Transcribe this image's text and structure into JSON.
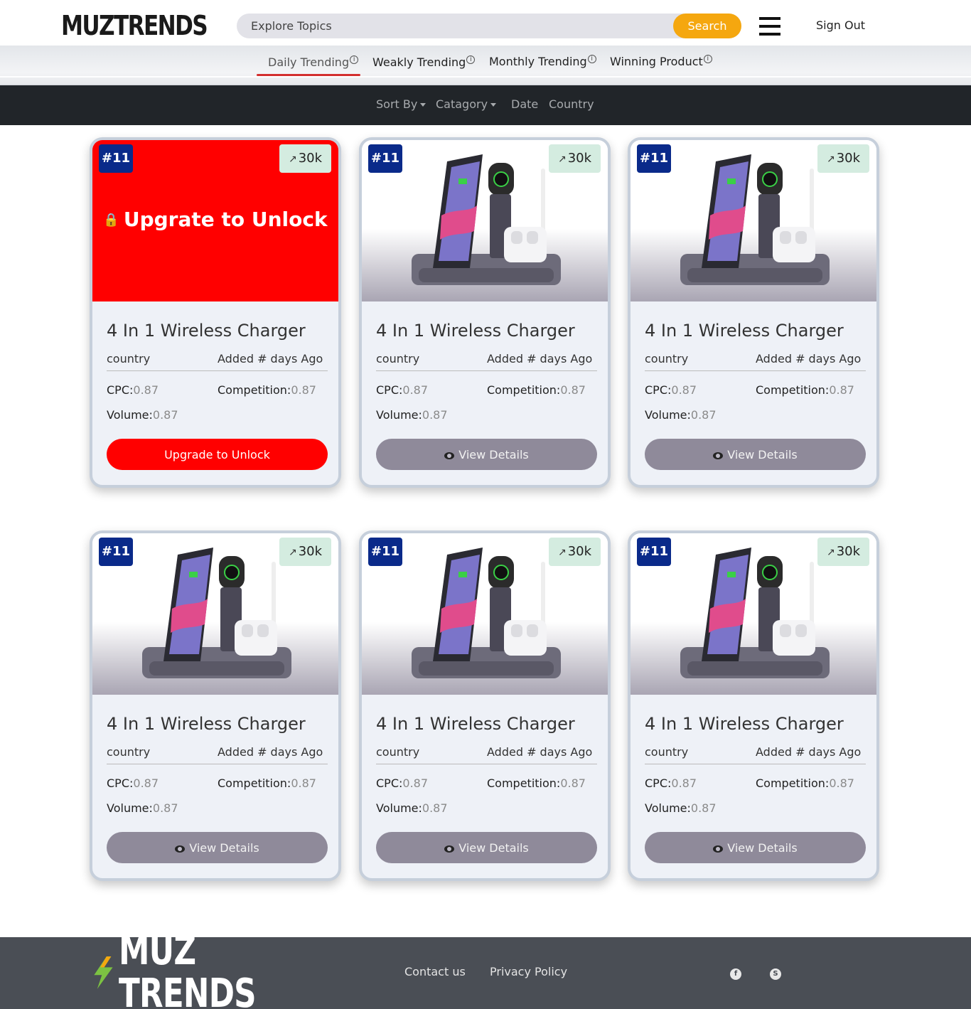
{
  "header": {
    "logo_text": "MUZTRENDS",
    "search": {
      "placeholder": "Explore Topics",
      "button_label": "Search"
    },
    "sign_out_label": "Sign Out"
  },
  "tabs": [
    {
      "label": "Daily Trending",
      "active": true
    },
    {
      "label": "Weakly Trending",
      "active": false
    },
    {
      "label": "Monthly Trending",
      "active": false
    },
    {
      "label": "Winning Product",
      "active": false
    }
  ],
  "filters": [
    {
      "label": "Sort By",
      "dropdown": true
    },
    {
      "label": "Catagory",
      "dropdown": true
    },
    {
      "label": "Date",
      "dropdown": false
    },
    {
      "label": "Country",
      "dropdown": false
    }
  ],
  "cards": [
    {
      "rank": "#11",
      "trend": "30k",
      "locked": true,
      "lock_overlay": "Upgrate to Unlock",
      "title": "4 In 1 Wireless Charger",
      "country": "country",
      "added": "Added # days Ago",
      "cpc_label": "CPC:",
      "cpc": "0.87",
      "competition_label": "Competition:",
      "competition": "0.87",
      "volume_label": "Volume:",
      "volume": "0.87",
      "button_label": "Upgrade to Unlock"
    },
    {
      "rank": "#11",
      "trend": "30k",
      "locked": false,
      "title": "4 In 1 Wireless Charger",
      "country": "country",
      "added": "Added # days Ago",
      "cpc_label": "CPC:",
      "cpc": "0.87",
      "competition_label": "Competition:",
      "competition": "0.87",
      "volume_label": "Volume:",
      "volume": "0.87",
      "button_label": "View Details"
    },
    {
      "rank": "#11",
      "trend": "30k",
      "locked": false,
      "title": "4 In 1 Wireless Charger",
      "country": "country",
      "added": "Added # days Ago",
      "cpc_label": "CPC:",
      "cpc": "0.87",
      "competition_label": "Competition:",
      "competition": "0.87",
      "volume_label": "Volume:",
      "volume": "0.87",
      "button_label": "View Details"
    },
    {
      "rank": "#11",
      "trend": "30k",
      "locked": false,
      "title": "4 In 1 Wireless Charger",
      "country": "country",
      "added": "Added # days Ago",
      "cpc_label": "CPC:",
      "cpc": "0.87",
      "competition_label": "Competition:",
      "competition": "0.87",
      "volume_label": "Volume:",
      "volume": "0.87",
      "button_label": "View Details"
    },
    {
      "rank": "#11",
      "trend": "30k",
      "locked": false,
      "title": "4 In 1 Wireless Charger",
      "country": "country",
      "added": "Added # days Ago",
      "cpc_label": "CPC:",
      "cpc": "0.87",
      "competition_label": "Competition:",
      "competition": "0.87",
      "volume_label": "Volume:",
      "volume": "0.87",
      "button_label": "View Details"
    },
    {
      "rank": "#11",
      "trend": "30k",
      "locked": false,
      "title": "4 In 1 Wireless Charger",
      "country": "country",
      "added": "Added # days Ago",
      "cpc_label": "CPC:",
      "cpc": "0.87",
      "competition_label": "Competition:",
      "competition": "0.87",
      "volume_label": "Volume:",
      "volume": "0.87",
      "button_label": "View Details"
    }
  ],
  "footer": {
    "logo_text": "MUZ TRENDS",
    "links": [
      "Contact us",
      "Privacy Policy"
    ],
    "social_icons": [
      "facebook-icon",
      "skype-icon"
    ]
  },
  "colors": {
    "accent": "#f5a70f",
    "locked": "#ff0000",
    "rank_badge": "#0a2a8a",
    "trend_badge": "#d4ece0",
    "view_button": "#8f8a9a",
    "dark_bar": "#212529",
    "footer": "#4a4e55"
  }
}
